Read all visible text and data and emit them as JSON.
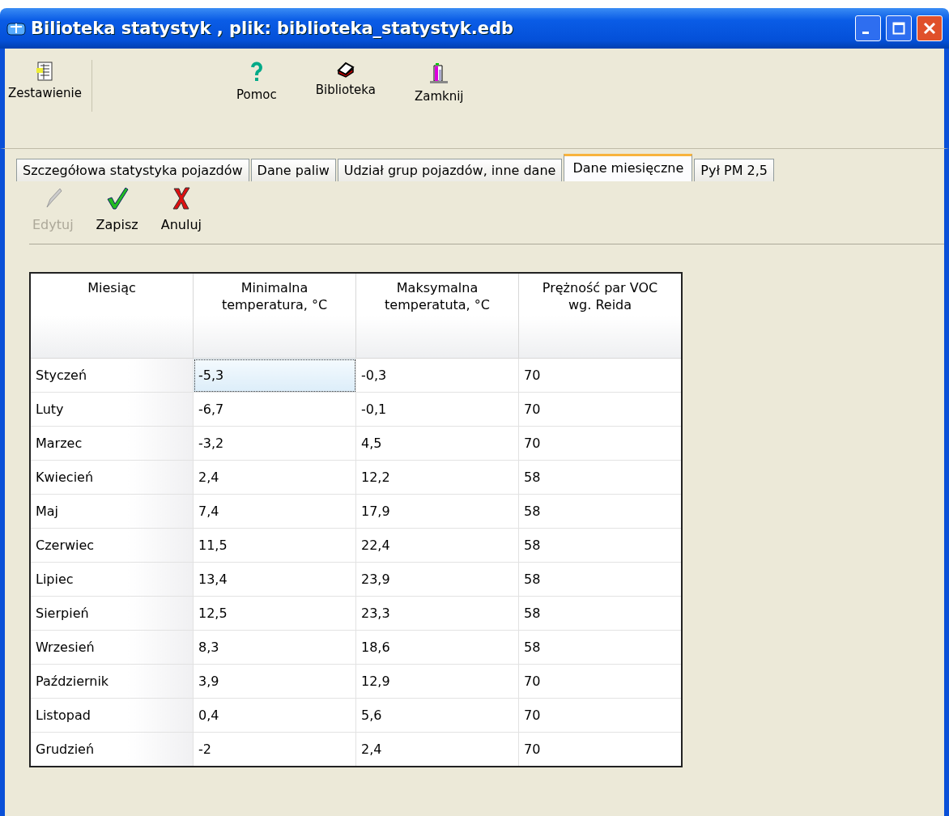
{
  "window": {
    "title": "Bilioteka statystyk , plik: biblioteka_statystyk.edb"
  },
  "toolbar": [
    {
      "kind": "report",
      "label": "Zestawienie"
    },
    {
      "kind": "help",
      "label": "Pomoc"
    },
    {
      "kind": "library",
      "label": "Biblioteka"
    },
    {
      "kind": "close",
      "label": "Zamknij"
    }
  ],
  "tabs": [
    {
      "label": "Szczegółowa statystyka pojazdów",
      "selected": false
    },
    {
      "label": "Dane paliw",
      "selected": false
    },
    {
      "label": "Udział grup pojazdów, inne dane",
      "selected": false
    },
    {
      "label": "Dane miesięczne",
      "selected": true
    },
    {
      "label": "Pył PM 2,5",
      "selected": false
    }
  ],
  "edit_toolbar": [
    {
      "kind": "edit",
      "label": "Edytuj",
      "disabled": true
    },
    {
      "kind": "save",
      "label": "Zapisz",
      "disabled": false
    },
    {
      "kind": "cancel",
      "label": "Anuluj",
      "disabled": false
    }
  ],
  "table": {
    "columns": [
      "Miesiąc",
      "Minimalna temperatura, °C",
      "Maksymalna temperatuta, °C",
      "Prężność par VOC wg. Reida"
    ],
    "rows": [
      {
        "cells": [
          "Styczeń",
          "-5,3",
          "-0,3",
          "70"
        ],
        "selected": true
      },
      {
        "cells": [
          "Luty",
          "-6,7",
          "-0,1",
          "70"
        ],
        "selected": false
      },
      {
        "cells": [
          "Marzec",
          "-3,2",
          "4,5",
          "70"
        ],
        "selected": false
      },
      {
        "cells": [
          "Kwiecień",
          "2,4",
          "12,2",
          "58"
        ],
        "selected": false
      },
      {
        "cells": [
          "Maj",
          "7,4",
          "17,9",
          "58"
        ],
        "selected": false
      },
      {
        "cells": [
          "Czerwiec",
          "11,5",
          "22,4",
          "58"
        ],
        "selected": false
      },
      {
        "cells": [
          "Lipiec",
          "13,4",
          "23,9",
          "58"
        ],
        "selected": false
      },
      {
        "cells": [
          "Sierpień",
          "12,5",
          "23,3",
          "58"
        ],
        "selected": false
      },
      {
        "cells": [
          "Wrzesień",
          "8,3",
          "18,6",
          "58"
        ],
        "selected": false
      },
      {
        "cells": [
          "Październik",
          "3,9",
          "12,9",
          "70"
        ],
        "selected": false
      },
      {
        "cells": [
          "Listopad",
          "0,4",
          "5,6",
          "70"
        ],
        "selected": false
      },
      {
        "cells": [
          "Grudzień",
          "-2",
          "2,4",
          "70"
        ],
        "selected": false
      }
    ]
  }
}
